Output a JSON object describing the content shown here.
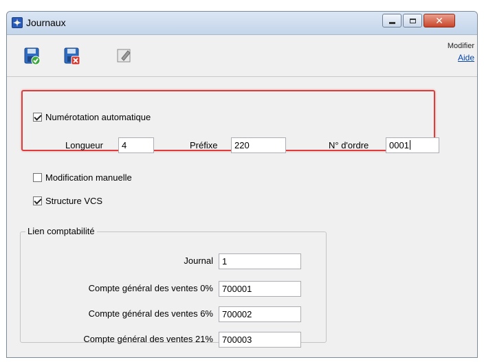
{
  "window": {
    "title": "Journaux"
  },
  "toolbar": {
    "icons": [
      "save-confirm-icon",
      "save-cancel-icon",
      "edit-icon"
    ],
    "modifier_label": "Modifier",
    "help_link": "Aide"
  },
  "numbering": {
    "auto_label": "Numérotation automatique",
    "auto_checked": true,
    "length_label": "Longueur",
    "length_value": "4",
    "prefix_label": "Préfixe",
    "prefix_value": "220",
    "order_label": "N° d'ordre",
    "order_value": "0001"
  },
  "options": {
    "manual_label": "Modification manuelle",
    "manual_checked": false,
    "vcs_label": "Structure VCS",
    "vcs_checked": true
  },
  "accounting": {
    "group_title": "Lien comptabilité",
    "journal_label": "Journal",
    "journal_value": "1",
    "sales0_label": "Compte général des ventes 0%",
    "sales0_value": "700001",
    "sales6_label": "Compte général des ventes 6%",
    "sales6_value": "700002",
    "sales21_label": "Compte général des ventes 21%",
    "sales21_value": "700003"
  },
  "colors": {
    "highlight": "#e03a3a",
    "link": "#0645ad"
  }
}
